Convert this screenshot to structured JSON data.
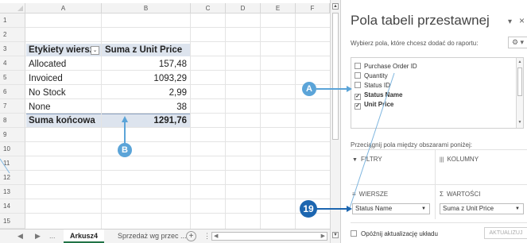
{
  "spreadsheet": {
    "columns": [
      "A",
      "B",
      "C",
      "D",
      "E",
      "F"
    ],
    "rows": [
      "1",
      "2",
      "3",
      "4",
      "5",
      "6",
      "7",
      "8",
      "9",
      "10",
      "11",
      "12",
      "13",
      "14",
      "15"
    ],
    "pivot": {
      "header_row_label": "Etykiety wierszy",
      "header_value_label": "Suma z Unit Price",
      "filter_glyph": "⌄",
      "data": [
        {
          "label": "Allocated",
          "value": "157,48"
        },
        {
          "label": "Invoiced",
          "value": "1093,29"
        },
        {
          "label": "No Stock",
          "value": "2,99"
        },
        {
          "label": "None",
          "value": "38"
        }
      ],
      "total_label": "Suma końcowa",
      "total_value": "1291,76"
    },
    "tabs": {
      "nav_prev": "◀",
      "nav_next": "▶",
      "ellipsis": "...",
      "active": "Arkusz4",
      "inactive": "Sprzedaż wg przec ...",
      "add": "+",
      "more": "⋮",
      "scroll_left": "◀",
      "scroll_right": "▶"
    },
    "vscroll": {
      "up": "▲",
      "down": "▼"
    }
  },
  "pivot_pane": {
    "title": "Pola tabeli przestawnej",
    "dropdown_glyph": "▾",
    "close_glyph": "×",
    "subtitle": "Wybierz pola, które chcesz dodać do raportu:",
    "gear_label": "⚙ ▾",
    "fields": [
      {
        "label": "Purchase Order ID",
        "checked": false
      },
      {
        "label": "Quantity",
        "checked": false
      },
      {
        "label": "Status ID",
        "checked": false
      },
      {
        "label": "Status Name",
        "checked": true
      },
      {
        "label": "Unit Price",
        "checked": true
      }
    ],
    "check_glyph": "✓",
    "drag_label": "Przeciągnij pola między obszarami poniżej:",
    "areas": {
      "filters": "FILTRY",
      "filters_icon": "▼",
      "columns": "KOLUMNY",
      "columns_icon": "|||",
      "rows": "WIERSZE",
      "rows_icon": "≡",
      "values": "WARTOŚCI",
      "values_icon": "Σ"
    },
    "rows_value": "Status Name",
    "values_value": "Suma z Unit Price",
    "caret": "▼",
    "defer_label": "Opóźnij aktualizację układu",
    "update_button": "AKTUALIZUJ"
  },
  "callouts": {
    "a": "A",
    "b": "B",
    "step": "19"
  }
}
